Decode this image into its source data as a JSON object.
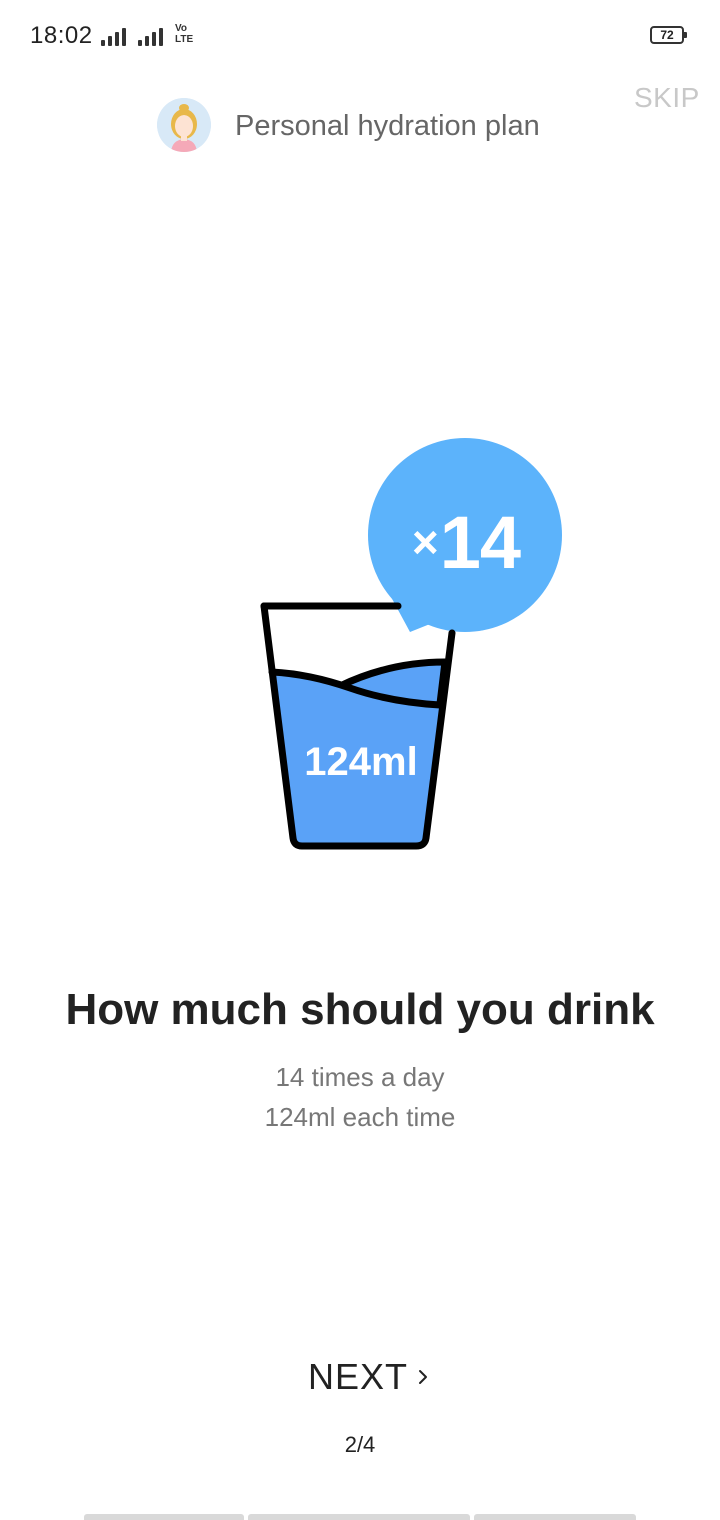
{
  "status_bar": {
    "time": "18:02",
    "network_label": "VoLTE",
    "battery": "72"
  },
  "header": {
    "title": "Personal hydration plan",
    "skip_label": "SKIP"
  },
  "illustration": {
    "times_symbol": "×",
    "times_count": "14",
    "glass_amount": "124ml"
  },
  "content": {
    "headline": "How much should you drink",
    "line1": "14 times a day",
    "line2": "124ml each time"
  },
  "footer": {
    "next_label": "NEXT",
    "page_indicator": "2/4"
  },
  "colors": {
    "water": "#5aa2f7",
    "bubble": "#5cb3fb",
    "outline": "#000000"
  },
  "icons": [
    "avatar-icon",
    "chevron-right-icon",
    "signal-icon",
    "battery-icon"
  ]
}
